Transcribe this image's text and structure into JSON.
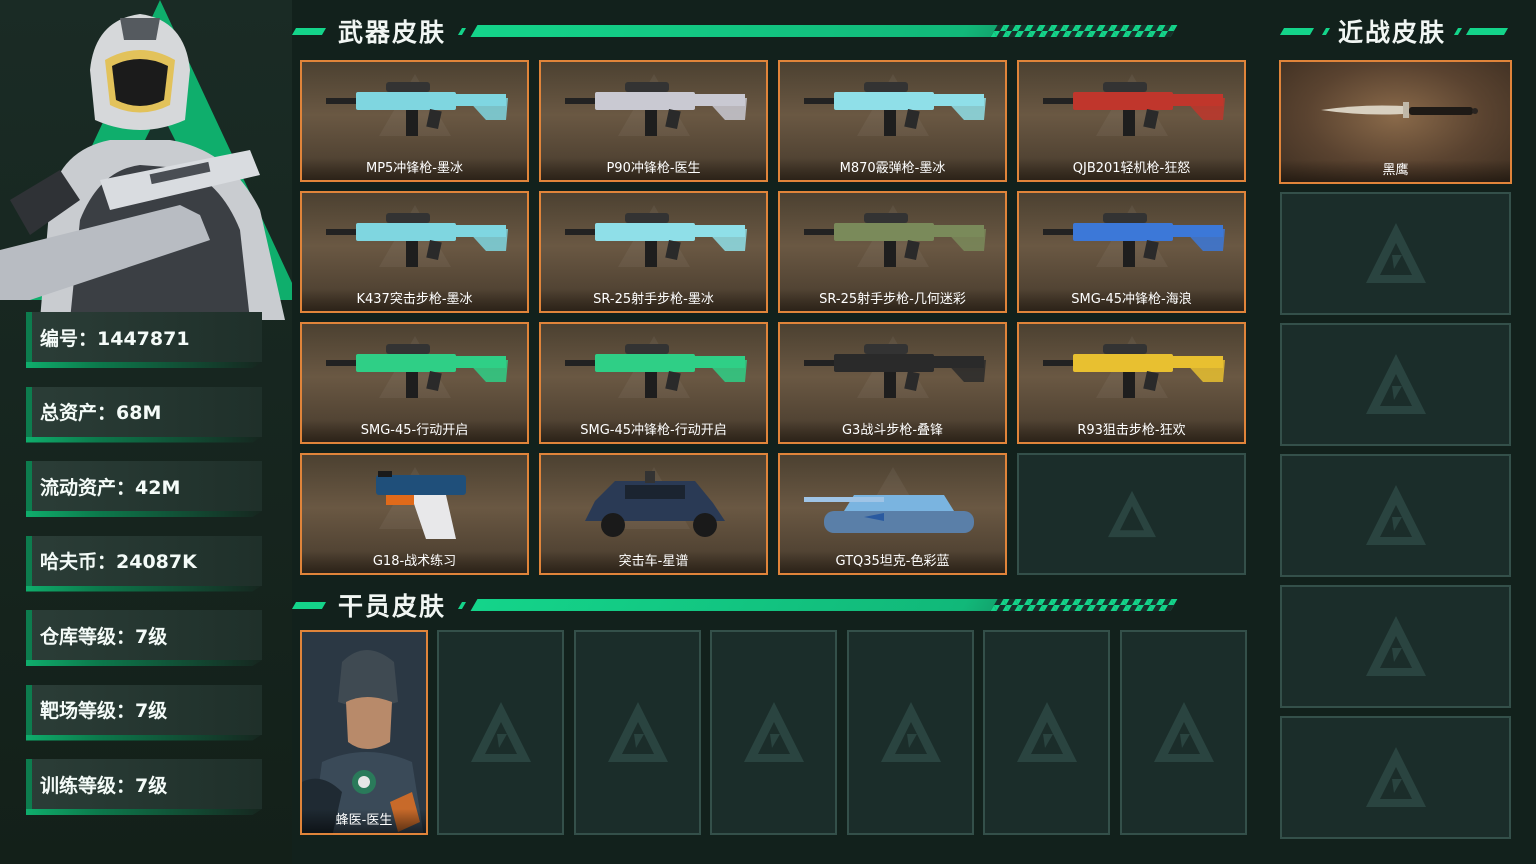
{
  "player": {
    "stats": [
      {
        "label": "编号：1447871"
      },
      {
        "label": "总资产：68M"
      },
      {
        "label": "流动资产：42M"
      },
      {
        "label": "哈夫币：24087K"
      },
      {
        "label": "仓库等级：7级"
      },
      {
        "label": "靶场等级：7级"
      },
      {
        "label": "训练等级：7级"
      }
    ]
  },
  "sections": {
    "weapon_title": "武器皮肤",
    "agent_title": "干员皮肤",
    "melee_title": "近战皮肤"
  },
  "weapons": [
    {
      "name": "MP5冲锋枪-墨冰",
      "color": "#7fd6e0"
    },
    {
      "name": "P90冲锋枪-医生",
      "color": "#c9c9d2"
    },
    {
      "name": "M870霰弹枪-墨冰",
      "color": "#8fdfe8"
    },
    {
      "name": "QJB201轻机枪-狂怒",
      "color": "#c0362c"
    },
    {
      "name": "K437突击步枪-墨冰",
      "color": "#7fd6e0"
    },
    {
      "name": "SR-25射手步枪-墨冰",
      "color": "#8fdfe8"
    },
    {
      "name": "SR-25射手步枪-几何迷彩",
      "color": "#7a8a5a"
    },
    {
      "name": "SMG-45冲锋枪-海浪",
      "color": "#3c78d8"
    },
    {
      "name": "SMG-45-行动开启",
      "color": "#2fcf86"
    },
    {
      "name": "SMG-45冲锋枪-行动开启",
      "color": "#2fcf86"
    },
    {
      "name": "G3战斗步枪-叠锋",
      "color": "#2a2a2a"
    },
    {
      "name": "R93狙击步枪-狂欢",
      "color": "#e8c030"
    },
    {
      "name": "G18-战术练习",
      "color": "#1f4f7a"
    },
    {
      "name": "突击车-星谱",
      "color": "#2a3a55"
    },
    {
      "name": "GTQ35坦克-色彩蓝",
      "color": "#7ab4e0"
    }
  ],
  "agents": [
    {
      "name": "蜂医-医生"
    }
  ],
  "melee": [
    {
      "name": "黑鹰"
    }
  ],
  "colors": {
    "accent": "#14d48a",
    "card_border": "#e0843a",
    "background": "#12211c"
  }
}
